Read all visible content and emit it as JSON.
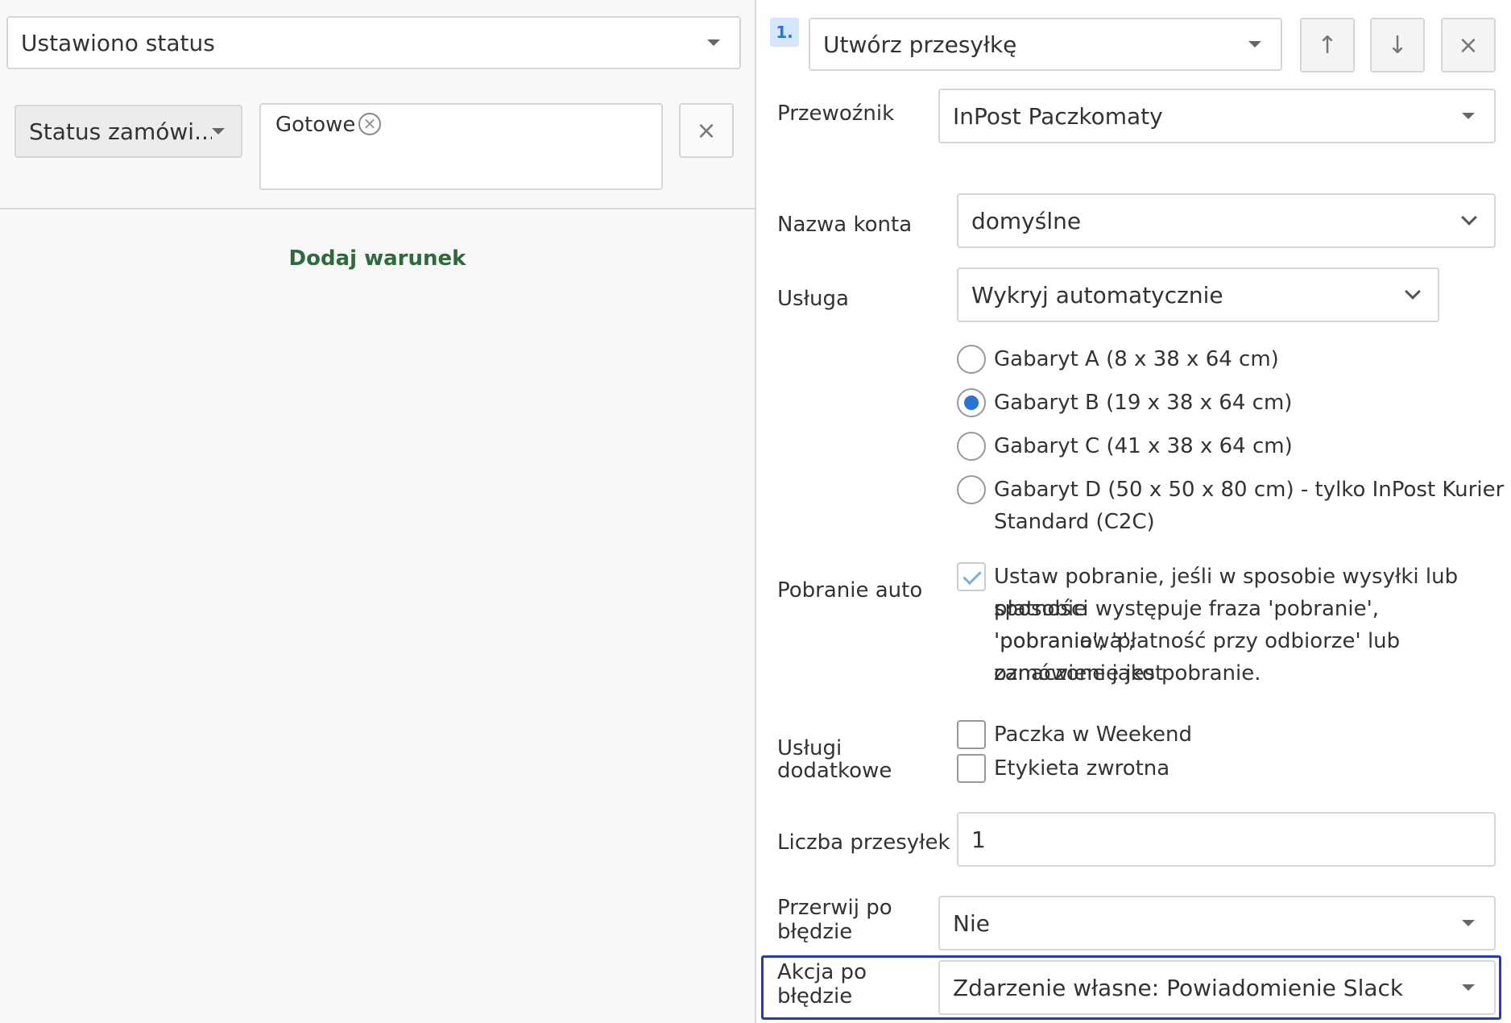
{
  "left": {
    "trigger_select": "Ustawiono status",
    "condition": {
      "field_select": "Status zamówi...",
      "tag_value": "Gotowe"
    },
    "add_condition": "Dodaj warunek"
  },
  "right": {
    "step_number": "1.",
    "action_select": "Utwórz przesyłkę",
    "fields": {
      "carrier_label": "Przewoźnik",
      "carrier_value": "InPost Paczkomaty",
      "account_label": "Nazwa konta",
      "account_value": "domyślne",
      "service_label": "Usługa",
      "service_value": "Wykryj automatycznie",
      "sizes": [
        {
          "label": "Gabaryt A (8 x 38 x 64 cm)",
          "selected": false
        },
        {
          "label": "Gabaryt B (19 x 38 x 64 cm)",
          "selected": true
        },
        {
          "label": "Gabaryt C (41 x 38 x 64 cm)",
          "selected": false
        },
        {
          "label": "Gabaryt D (50 x 50 x 80 cm) - tylko InPost Kurier",
          "label2": "Standard (C2C)",
          "selected": false
        }
      ],
      "cod_label": "Pobranie auto",
      "cod_checked": true,
      "cod_text": [
        "Ustaw pobranie, jeśli w sposobie wysyłki lub sposobie",
        "płatności występuje fraza 'pobranie', 'pobraniowa',",
        "'pobrania', 'płatność przy odbiorze' lub zamówienie jest",
        "oznaczone jako pobranie."
      ],
      "extra_label_1": "Usługi",
      "extra_label_2": "dodatkowe",
      "extras": [
        {
          "label": "Paczka w Weekend",
          "checked": false
        },
        {
          "label": "Etykieta zwrotna",
          "checked": false
        }
      ],
      "count_label": "Liczba przesyłek",
      "count_value": "1",
      "stop_label_1": "Przerwij po",
      "stop_label_2": "błędzie",
      "stop_value": "Nie",
      "after_error_label_1": "Akcja po",
      "after_error_label_2": "błędzie",
      "after_error_value": "Zdarzenie własne: Powiadomienie Slack"
    },
    "buttons": {
      "up": "↑",
      "down": "↓",
      "close": "×"
    }
  },
  "colors": {
    "accent_blue": "#2a73d9",
    "link_green": "#2e6b3a",
    "highlight_border": "#1d3fbf"
  }
}
